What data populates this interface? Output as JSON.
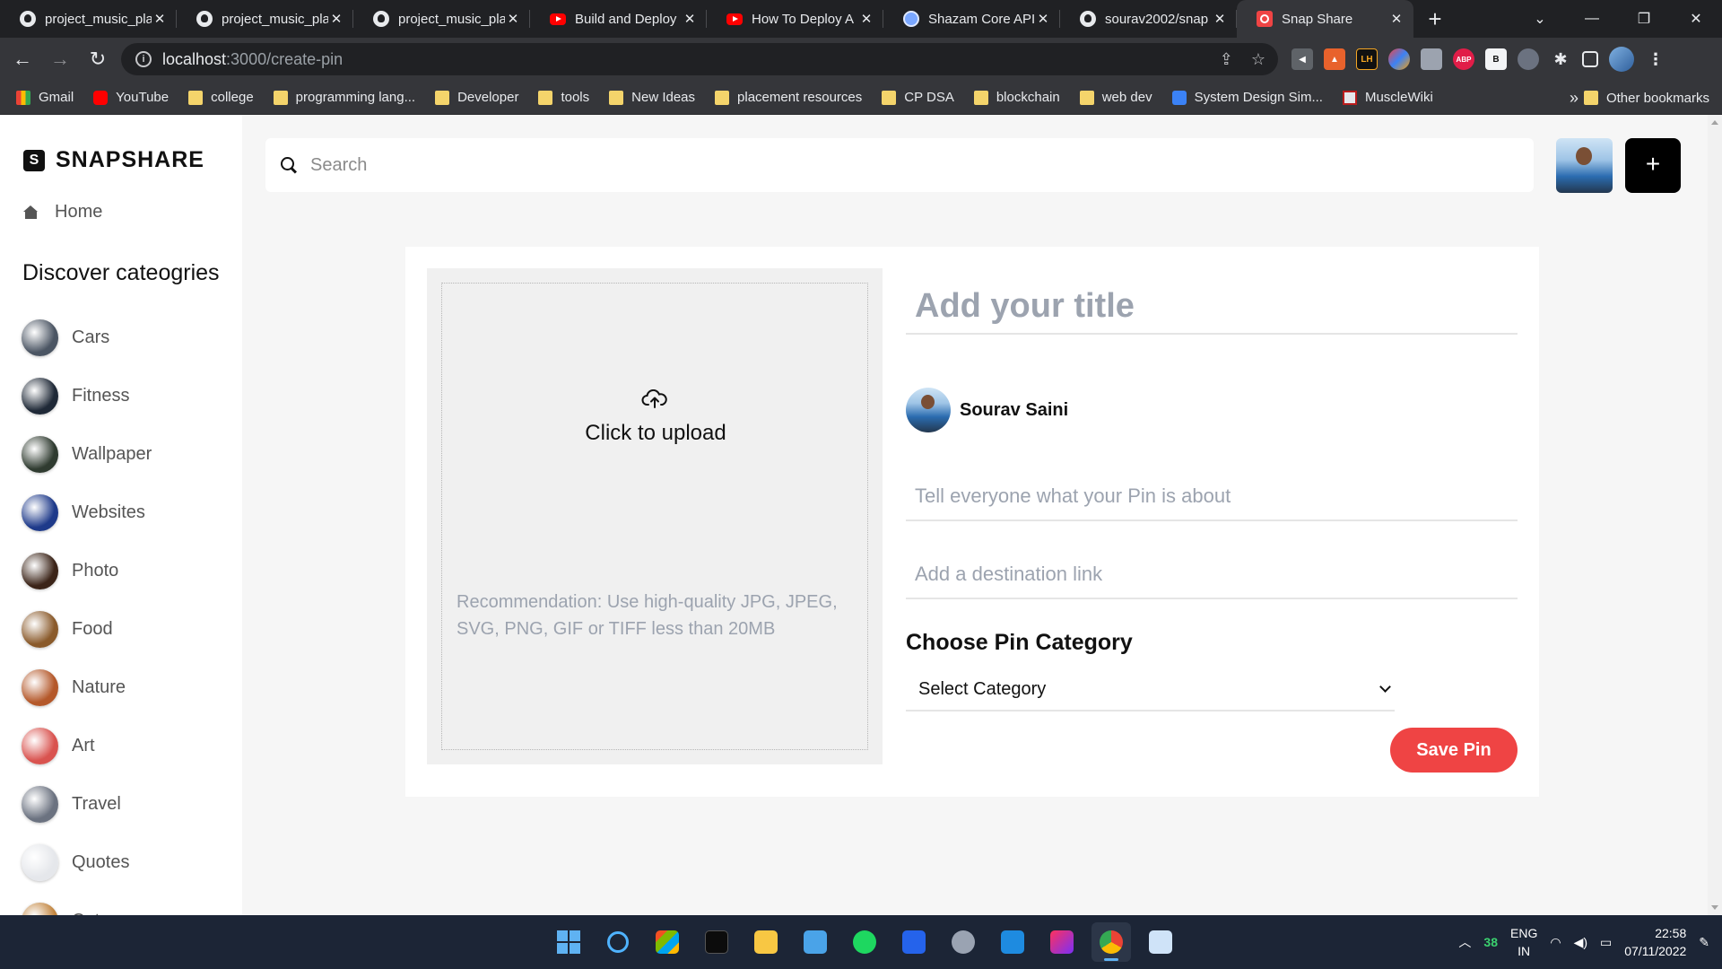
{
  "browser": {
    "tabs": [
      {
        "title": "project_music_pla",
        "icon": "github-icon",
        "active": false
      },
      {
        "title": "project_music_pla",
        "icon": "github-icon",
        "active": false
      },
      {
        "title": "project_music_pla",
        "icon": "github-icon",
        "active": false
      },
      {
        "title": "Build and Deploy",
        "icon": "youtube-icon",
        "active": false
      },
      {
        "title": "How To Deploy A",
        "icon": "youtube-icon",
        "active": false
      },
      {
        "title": "Shazam Core API",
        "icon": "shazam-icon",
        "active": false
      },
      {
        "title": "sourav2002/snap",
        "icon": "github-icon",
        "active": false
      },
      {
        "title": "Snap Share",
        "icon": "snapshare-icon",
        "active": true
      }
    ],
    "close_glyph": "✕",
    "new_tab_glyph": "+",
    "url_host": "localhost",
    "url_path": ":3000/create-pin",
    "bookmarks": [
      {
        "label": "Gmail",
        "icon": "gmail-icon"
      },
      {
        "label": "YouTube",
        "icon": "youtube-icon"
      },
      {
        "label": "college",
        "icon": "folder-icon"
      },
      {
        "label": "programming lang...",
        "icon": "folder-icon"
      },
      {
        "label": "Developer",
        "icon": "folder-icon"
      },
      {
        "label": "tools",
        "icon": "folder-icon"
      },
      {
        "label": "New Ideas",
        "icon": "folder-icon"
      },
      {
        "label": "placement resources",
        "icon": "folder-icon"
      },
      {
        "label": "CP DSA",
        "icon": "folder-icon"
      },
      {
        "label": "blockchain",
        "icon": "folder-icon"
      },
      {
        "label": "web dev",
        "icon": "folder-icon"
      },
      {
        "label": "System Design Sim...",
        "icon": "system-design-icon"
      },
      {
        "label": "MuscleWiki",
        "icon": "musclewiki-icon"
      }
    ],
    "bookmarks_more": "»",
    "other_bookmarks": "Other bookmarks",
    "extension_badges": [
      "LH",
      "ABP",
      "B"
    ]
  },
  "app": {
    "logo_mark": "S",
    "logo_text": "SNAPSHARE",
    "home_label": "Home",
    "discover_heading": "Discover cateogries",
    "categories": [
      {
        "label": "Cars",
        "thumb": "#4b5563"
      },
      {
        "label": "Fitness",
        "thumb": "#1f2937"
      },
      {
        "label": "Wallpaper",
        "thumb": "#2f3b30"
      },
      {
        "label": "Websites",
        "thumb": "#1e3a8a"
      },
      {
        "label": "Photo",
        "thumb": "#3b2418"
      },
      {
        "label": "Food",
        "thumb": "#8a5a2b"
      },
      {
        "label": "Nature",
        "thumb": "#b4582a"
      },
      {
        "label": "Art",
        "thumb": "#d9534f"
      },
      {
        "label": "Travel",
        "thumb": "#6b7280"
      },
      {
        "label": "Quotes",
        "thumb": "#e5e7eb"
      },
      {
        "label": "Cats",
        "thumb": "#c2853f"
      }
    ],
    "search_placeholder": "Search",
    "add_button_glyph": "+",
    "create_pin": {
      "upload_label": "Click to upload",
      "upload_recommendation": "Recommendation: Use high-quality JPG, JPEG, SVG, PNG, GIF or TIFF less than 20MB",
      "title_placeholder": "Add your title",
      "user_name": "Sourav Saini",
      "about_placeholder": "Tell everyone what your Pin is about",
      "destination_placeholder": "Add a destination link",
      "category_heading": "Choose Pin Category",
      "category_selected": "Select Category",
      "save_label": "Save Pin",
      "save_color": "#ef4444"
    }
  },
  "taskbar": {
    "apps": [
      "windows-start-icon",
      "cortana-icon",
      "store-icon",
      "terminal-icon",
      "file-explorer-icon",
      "notepad-icon",
      "spotify-icon",
      "whiteboard-icon",
      "settings-icon",
      "vscode-icon",
      "intellij-icon",
      "chrome-icon",
      "photos-icon"
    ],
    "tray_badge": "38",
    "lang_top": "ENG",
    "lang_bottom": "IN",
    "time": "22:58",
    "date": "07/11/2022"
  }
}
